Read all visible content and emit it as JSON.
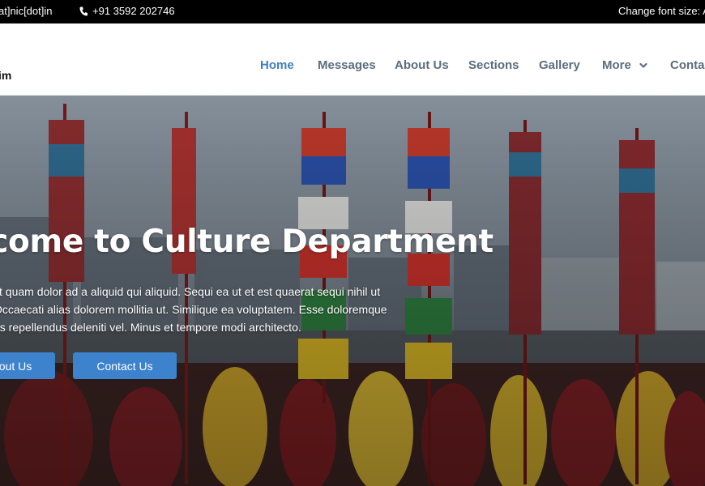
{
  "topbar": {
    "email": "at]nic[dot]in",
    "phone": "+91 3592 202746",
    "font_size_label": "Change font size:  A"
  },
  "header": {
    "brand": "im",
    "nav": {
      "home": "Home",
      "messages": "Messages",
      "about": "About Us",
      "sections": "Sections",
      "gallery": "Gallery",
      "more": "More",
      "contact": "Contac"
    }
  },
  "hero": {
    "title": "elcome to Culture Department",
    "description_lines": [
      "st quam dolor ad a aliquid qui aliquid. Sequi ea ut et est quaerat sequi nihil ut",
      "Occaecati alias dolorem mollitia ut. Similique ea voluptatem. Esse doloremque",
      "us repellendus deleniti vel. Minus et tempore modi architecto."
    ],
    "buttons": {
      "about": "out Us",
      "contact": "Contact Us"
    }
  },
  "icons": {
    "phone": "phone-icon",
    "chevron": "chevron-down-icon"
  },
  "colors": {
    "accent": "#3d82cc",
    "nav_active": "#3d7ec2",
    "nav_text": "#5b6d7d",
    "topbar_bg": "#000000"
  }
}
